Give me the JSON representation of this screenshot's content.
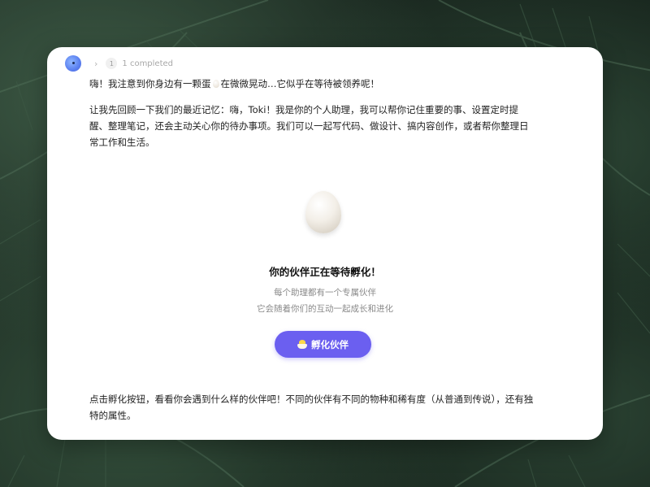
{
  "header": {
    "step_number": "1",
    "status_text": "1 completed"
  },
  "message": {
    "greeting_part1": "嗨！我注意到你身边有一颗蛋",
    "greeting_part2": "在微微晃动…它似乎在等待被领养呢！",
    "intro_line1": "让我先回顾一下我们的最近记忆：嗨，Toki！我是你的个人助理，我可以帮你记住重要的事、设置定时提",
    "intro_line2": "醒、整理笔记，还会主动关心你的待办事项。我们可以一起写代码、做设计、搞内容创作，或者帮你整理日",
    "intro_line3": "常工作和生活。",
    "closing_line1": "点击孵化按钮，看看你会遇到什么样的伙伴吧！不同的伙伴有不同的物种和稀有度（从普通到传说），还有独",
    "closing_line2": "特的属性。"
  },
  "hatch": {
    "title": "你的伙伴正在等待孵化！",
    "subtitle_line1": "每个助理都有一个专属伙伴",
    "subtitle_line2": "它会随着你们的互动一起成长和进化",
    "button_label": "孵化伙伴"
  },
  "colors": {
    "accent": "#6b5ff0",
    "background_leaves": "#1b2a22"
  },
  "icons": {
    "avatar": "assistant-avatar",
    "chevron": "chevron-right-icon",
    "egg": "egg-icon",
    "button_icon": "hatching-chick-icon"
  }
}
